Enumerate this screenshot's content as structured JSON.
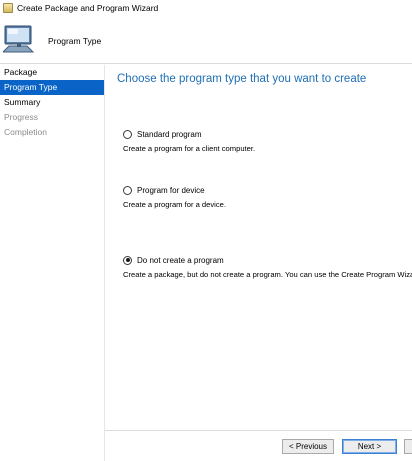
{
  "window": {
    "title": "Create Package and Program Wizard",
    "icon": "wizard-app-icon"
  },
  "header": {
    "title": "Program Type",
    "icon": "computer-icon"
  },
  "sidebar": {
    "items": [
      {
        "label": "Package",
        "state": "done"
      },
      {
        "label": "Program Type",
        "state": "current"
      },
      {
        "label": "Summary",
        "state": "pending"
      },
      {
        "label": "Progress",
        "state": "disabled"
      },
      {
        "label": "Completion",
        "state": "disabled"
      }
    ]
  },
  "main": {
    "heading": "Choose the program type that you want to create",
    "options": [
      {
        "label": "Standard program",
        "description": "Create a program for a client computer.",
        "selected": false
      },
      {
        "label": "Program for device",
        "description": "Create a program for a device.",
        "selected": false
      },
      {
        "label": "Do not create a program",
        "description": "Create a package, but do not create a program. You can use the Create Program Wizard",
        "selected": true
      }
    ]
  },
  "footer": {
    "previous_label": "< Previous",
    "next_label": "Next >",
    "extra_label": ""
  },
  "colors": {
    "accent": "#0a64c8",
    "heading": "#1f6fb5"
  }
}
